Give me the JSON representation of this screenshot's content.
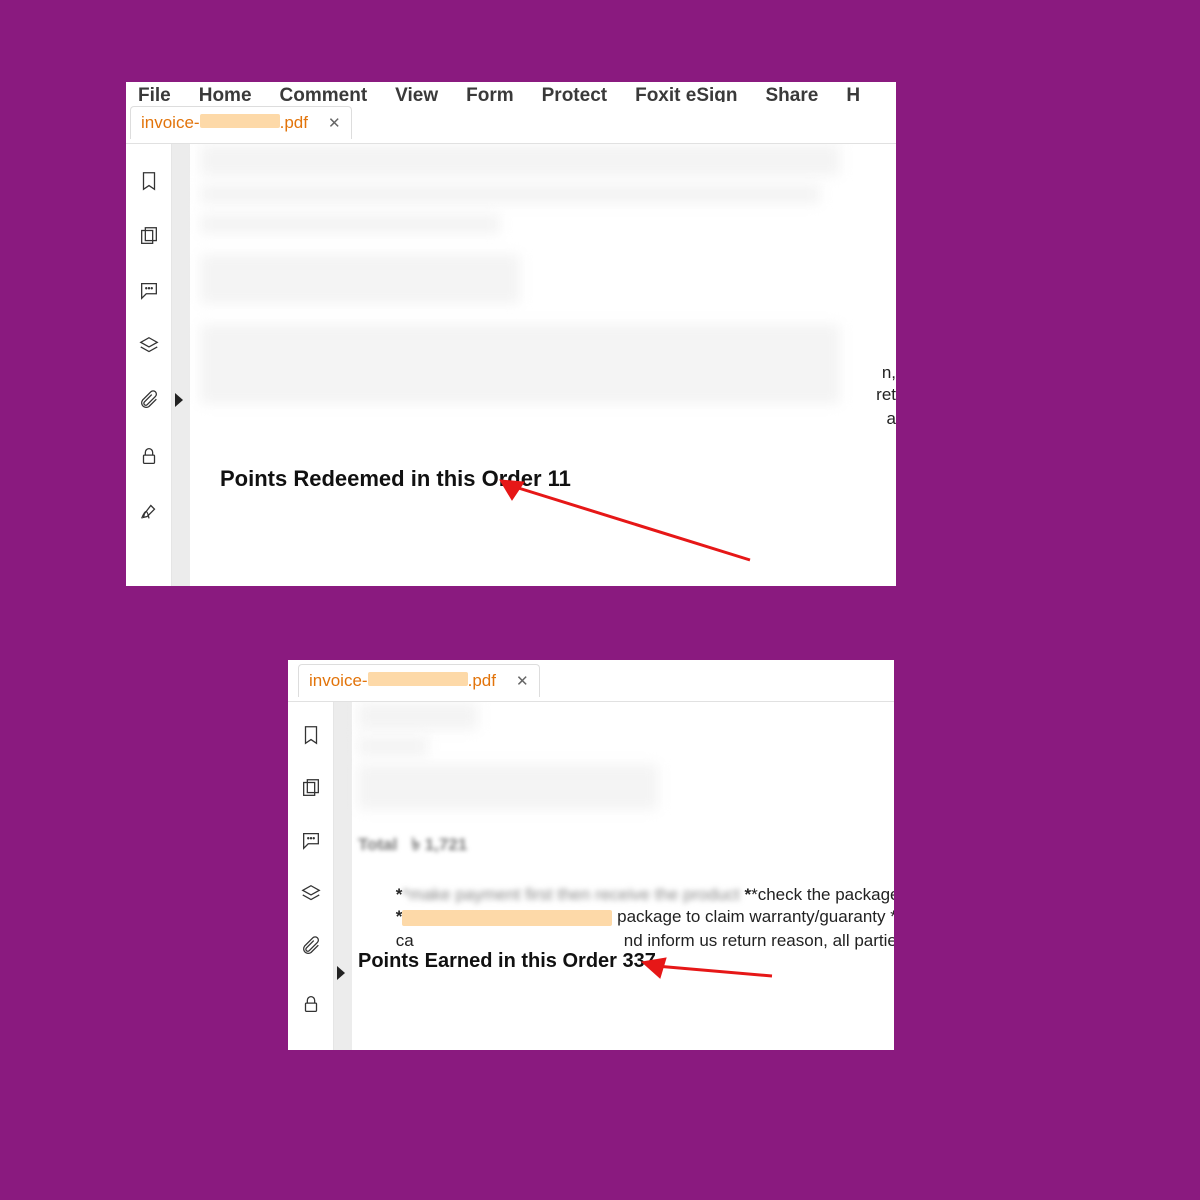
{
  "menu": {
    "file": "File",
    "home": "Home",
    "comment": "Comment",
    "view": "View",
    "form": "Form",
    "protect": "Protect",
    "foxit_esign": "Foxit eSign",
    "share": "Share",
    "partial": "H"
  },
  "tab": {
    "prefix": "invoice-",
    "suffix": ".pdf"
  },
  "doc1": {
    "points_line": "Points Redeemed in this Order 11",
    "frag1": "n,",
    "frag2": "ret",
    "frag3": "a"
  },
  "doc2": {
    "total_line": "Total   ৳ 1,721",
    "para_line1_a": "*make payment first then receive the product ",
    "para_line1_b": "*check the package in fro",
    "para_line2_b": " package to claim warranty/guaranty *",
    "para_line3_a": "ca",
    "para_line3_b": "nd inform us return reason, all parties r",
    "points_line": "Points Earned in this Order 337"
  }
}
